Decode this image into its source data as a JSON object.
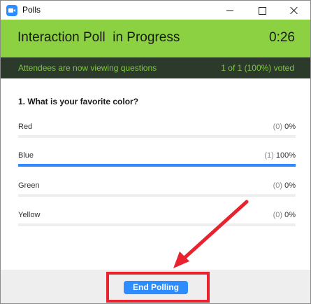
{
  "window": {
    "title": "Polls"
  },
  "header": {
    "title": "Interaction Poll  in Progress",
    "timer": "0:26",
    "status_left": "Attendees are now viewing questions",
    "status_right": "1 of 1 (100%) voted",
    "colors": {
      "green": "#8cd142",
      "dark_bar": "#2c3a2c",
      "status_text": "#7fc83f"
    }
  },
  "poll": {
    "question": "1. What is your favorite color?",
    "options": [
      {
        "label": "Red",
        "count": "(0)",
        "percent": "0%",
        "fill": 0
      },
      {
        "label": "Blue",
        "count": "(1)",
        "percent": "100%",
        "fill": 1
      },
      {
        "label": "Green",
        "count": "(0)",
        "percent": "0%",
        "fill": 0
      },
      {
        "label": "Yellow",
        "count": "(0)",
        "percent": "0%",
        "fill": 0
      }
    ],
    "bar_color": "#2d8cff"
  },
  "footer": {
    "end_label": "End Polling",
    "annotation_color": "#e8232f"
  }
}
